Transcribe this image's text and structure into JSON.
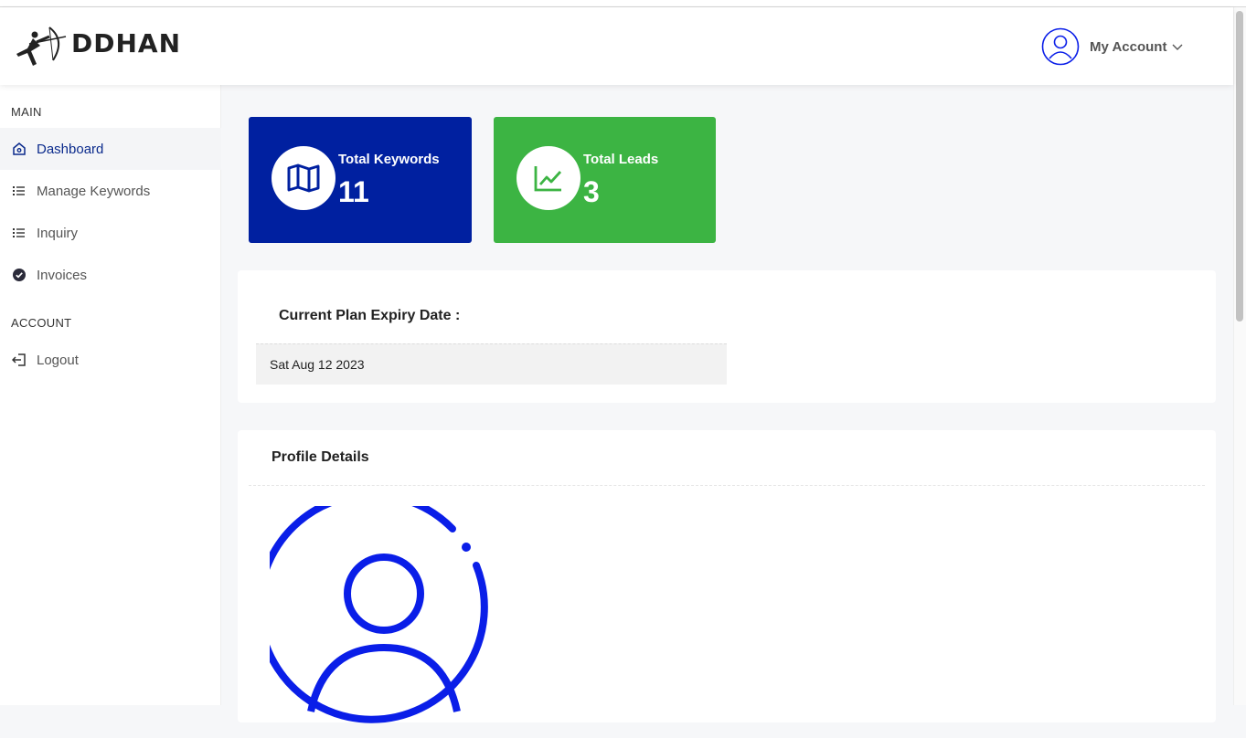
{
  "brand": {
    "name": "DDHAN"
  },
  "header": {
    "account_label": "My Account",
    "avatar_icon": "user-circle-icon",
    "chevron_icon": "chevron-down-icon"
  },
  "sidebar": {
    "sections": [
      {
        "label": "MAIN"
      },
      {
        "label": "ACCOUNT"
      }
    ],
    "items": [
      {
        "label": "Dashboard",
        "icon": "home-icon",
        "active": true
      },
      {
        "label": "Manage Keywords",
        "icon": "list-icon"
      },
      {
        "label": "Inquiry",
        "icon": "list-icon"
      },
      {
        "label": "Invoices",
        "icon": "check-badge-icon"
      },
      {
        "label": "Logout",
        "icon": "logout-icon"
      }
    ]
  },
  "stats": [
    {
      "title": "Total Keywords",
      "value": "11",
      "icon": "map-icon",
      "color": "#0020a0"
    },
    {
      "title": "Total Leads",
      "value": "3",
      "icon": "chart-line-icon",
      "color": "#3cb443"
    }
  ],
  "plan": {
    "title": "Current Plan Expiry Date :",
    "value": "Sat Aug 12 2023"
  },
  "profile": {
    "title": "Profile Details",
    "avatar_icon": "user-avatar-icon",
    "accent": "#0a1ee8"
  }
}
